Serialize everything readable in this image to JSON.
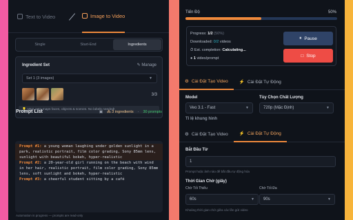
{
  "left": {
    "tabs": [
      {
        "label": "Text to Video"
      },
      {
        "label": "Image to Video"
      }
    ],
    "modes": [
      "Single",
      "Start-End",
      "Ingredients"
    ],
    "ingredient_set": {
      "title": "Ingredient Set",
      "manage_label": "Manage",
      "selected": "Set 1 (3 images)",
      "count": "3/3",
      "note": "VEO auto-maps faces, objects & scenes. No labels needed!"
    },
    "prompt_list": {
      "title": "Prompt List",
      "ingredients": "3 ingredients",
      "prompts_count": "30 prompts",
      "items": [
        {
          "label": "Prompt #1:",
          "text": " a young woman laughing under golden sunlight in a park, realistic portrait, film color grading, Sony 85mm lens, sunlight with beautiful bokeh, hyper-realistic"
        },
        {
          "label": "Prompt #2:",
          "text": " a 20-year-old girl running on the beach with wind in her hair, realistic portrait, film color grading, Sony 85mm lens, soft sunlight and bokeh, hyper-realistic"
        },
        {
          "label": "Prompt #3:",
          "text": " a cheerful student sitting by a café"
        }
      ]
    },
    "footer": "Automation in progress — prompts are read-only"
  },
  "right": {
    "progress": {
      "label": "Tiến Độ",
      "percent_text": "50%",
      "value": 0.5
    },
    "status": {
      "progress_prefix": "Progress: ",
      "progress_value": "1/2",
      "progress_pct": "(50%)",
      "downloaded_prefix": "Downloaded: ",
      "downloaded_value": "0/2",
      "downloaded_suffix": " videos",
      "est_prefix": "Est. completion: ",
      "est_value": "Calculating...",
      "rate_value": "1",
      "rate_suffix": " video/prompt"
    },
    "buttons": {
      "pause": "Pause",
      "stop": "Stop"
    },
    "tabs": [
      {
        "label": "Cài Đặt Tạo Video"
      },
      {
        "label": "Cài Đặt Tự Động"
      }
    ],
    "model_label": "Model",
    "model_value": "Veo 3.1 - Fast",
    "quality_label": "Tùy Chọn Chất Lượng",
    "quality_value": "720p (Mặc Định)",
    "cut_label": "Tỉ lệ khung hình",
    "start_from_label": "Bắt Đầu Từ",
    "start_from_value": "1",
    "start_from_hint": "Prompt hoặc ảnh nào để bắt đầu tự động hóa",
    "wait_label": "Thời Gian Chờ (giây)",
    "min_wait_label": "Chờ Tối Thiểu",
    "min_wait_value": "60s",
    "max_wait_label": "Chờ Tối Đa",
    "max_wait_value": "90s",
    "wait_hint": "Khoảng thời gian chờ giữa các lần gửi video"
  }
}
